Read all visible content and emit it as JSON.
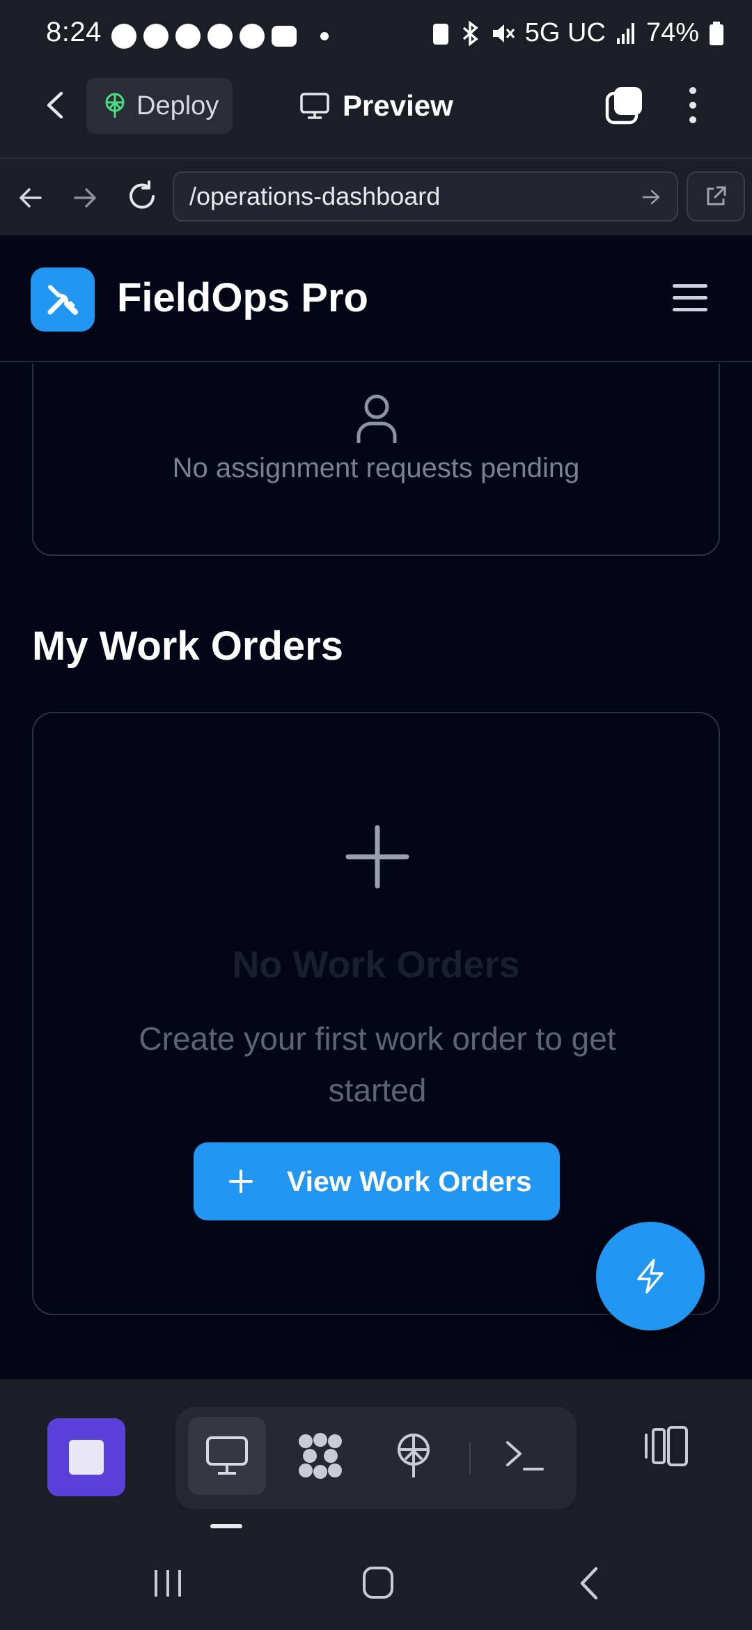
{
  "status_bar": {
    "time": "8:24",
    "network": "5G UC",
    "battery": "74%"
  },
  "app_bar": {
    "deploy_label": "Deploy",
    "preview_label": "Preview"
  },
  "browser": {
    "url": "/operations-dashboard"
  },
  "site": {
    "title": "FieldOps Pro"
  },
  "assignments": {
    "empty_message": "No assignment requests pending"
  },
  "work_orders": {
    "section_title": "My Work Orders",
    "empty_title": "No Work Orders",
    "empty_description": "Create your first work order to get started",
    "button_label": "View Work Orders"
  },
  "colors": {
    "accent": "#2196f3",
    "background": "#020617",
    "chrome": "#1b1e27",
    "stop_button": "#5b3fd9",
    "deploy_icon": "#4ade80"
  }
}
